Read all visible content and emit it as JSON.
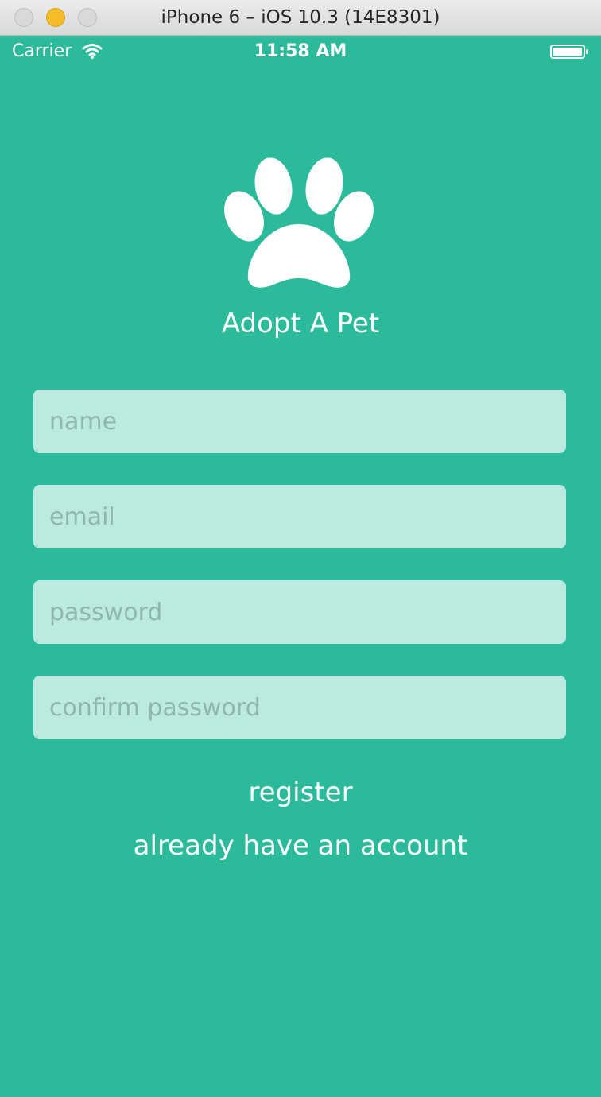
{
  "window": {
    "title": "iPhone 6 – iOS 10.3 (14E8301)"
  },
  "statusbar": {
    "carrier": "Carrier",
    "time": "11:58 AM",
    "wifi_icon": "wifi-icon",
    "battery_icon": "battery-icon"
  },
  "app": {
    "logo_icon": "paw-icon",
    "title": "Adopt A Pet",
    "background_color": "#2bbb9b",
    "field_color": "#bbeae0"
  },
  "form": {
    "name_placeholder": "name",
    "email_placeholder": "email",
    "password_placeholder": "password",
    "confirm_password_placeholder": "confirm password",
    "name_value": "",
    "email_value": "",
    "password_value": "",
    "confirm_password_value": ""
  },
  "actions": {
    "register_label": "register",
    "login_label": "already have an account"
  }
}
